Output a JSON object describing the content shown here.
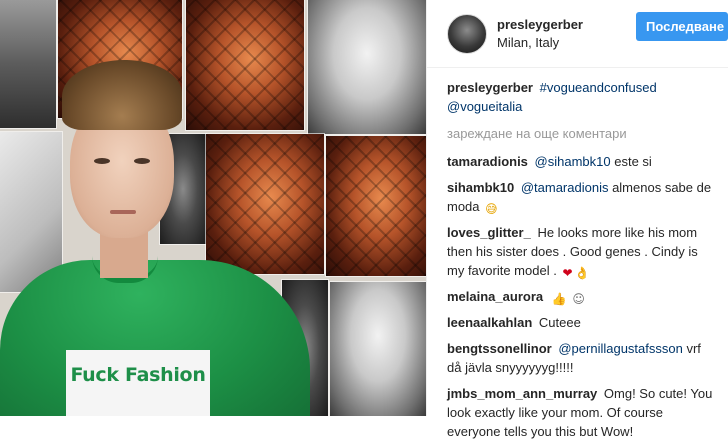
{
  "header": {
    "username": "presleygerber",
    "location": "Milan, Italy",
    "follow_label": "Последване"
  },
  "photo": {
    "shirt_text": "Fuck Fashion"
  },
  "caption": {
    "username": "presleygerber",
    "hashtag": "#vogueandconfused",
    "mention": "@vogueitalia"
  },
  "load_more_label": "зареждане на още коментари",
  "comments": [
    {
      "username": "tamaradionis",
      "mention": "@sihambk10",
      "text": " este si"
    },
    {
      "username": "sihambk10",
      "mention": "@tamaradionis",
      "text": " almenos sabe de moda",
      "emoji": "😅"
    },
    {
      "username": "loves_glitter_",
      "text": "He looks more like his mom then his sister does . Good genes . Cindy is my favorite model .",
      "emoji": "❤",
      "emoji2": "👌"
    },
    {
      "username": "melaina_aurora",
      "emoji": "👍",
      "emoji2": "☺"
    },
    {
      "username": "leenaalkahlan",
      "text": "Cuteee"
    },
    {
      "username": "bengtssonellinor",
      "mention": "@pernillagustafssson",
      "text": " vrf då jävla snyyyyyyg!!!!!"
    },
    {
      "username": "jmbs_mom_ann_murray",
      "text": "Omg! So cute! You look exactly like your mom. Of course everyone tells you this but Wow!"
    }
  ],
  "colors": {
    "accent": "#3897f0",
    "link": "#003569",
    "muted": "#999999",
    "text": "#262626"
  }
}
